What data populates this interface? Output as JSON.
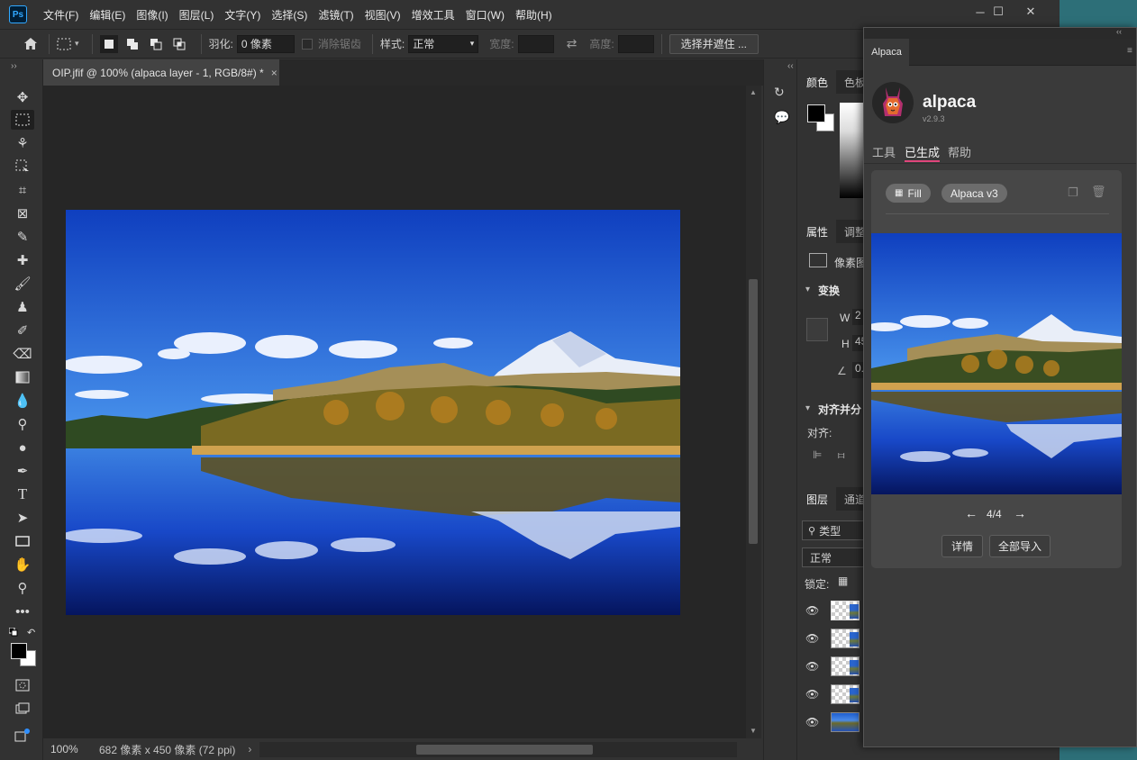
{
  "menubar": {
    "logo": "Ps",
    "items": [
      "文件(F)",
      "编辑(E)",
      "图像(I)",
      "图层(L)",
      "文字(Y)",
      "选择(S)",
      "滤镜(T)",
      "视图(V)",
      "增效工具",
      "窗口(W)",
      "帮助(H)"
    ],
    "window_controls": [
      "─",
      "☐",
      "✕"
    ]
  },
  "options": {
    "feather_label": "羽化:",
    "feather_value": "0 像素",
    "antialias_label": "消除锯齿",
    "style_label": "样式:",
    "style_value": "正常",
    "width_label": "宽度:",
    "height_label": "高度:",
    "select_mask_button": "选择并遮住 ..."
  },
  "document": {
    "tab_title": "OIP.jfif @ 100% (alpaca layer - 1, RGB/8#) *",
    "tab_close": "×",
    "zoom": "100%",
    "dimensions": "682 像素 x 450 像素 (72 ppi)",
    "status_arrow": "›"
  },
  "panels": {
    "color_tabs": [
      "颜色",
      "色板"
    ],
    "properties_tabs": [
      "属性",
      "调整"
    ],
    "properties_type": "像素图",
    "transform_header": "变换",
    "w_label": "W",
    "w_value": "2",
    "h_label": "H",
    "h_value": "45",
    "angle_value": "0.",
    "align_header": "对齐并分",
    "align_label": "对齐:",
    "layers_tabs": [
      "图层",
      "通道"
    ],
    "layers_search": "类型",
    "blend_mode": "正常",
    "lock_label": "锁定:",
    "layers_count": 5
  },
  "alpaca": {
    "tab": "Alpaca",
    "name": "alpaca",
    "version": "v2.9.3",
    "subtabs": [
      "工具",
      "已生成",
      "帮助"
    ],
    "active_subtab": "已生成",
    "chips": [
      "Fill",
      "Alpaca v3"
    ],
    "pager": "4/4",
    "buttons": [
      "详情",
      "全部导入"
    ],
    "accent": "#e0457b"
  },
  "collapse_arrows": {
    "left": "››",
    "panels": "‹‹",
    "alpaca": "‹‹"
  }
}
